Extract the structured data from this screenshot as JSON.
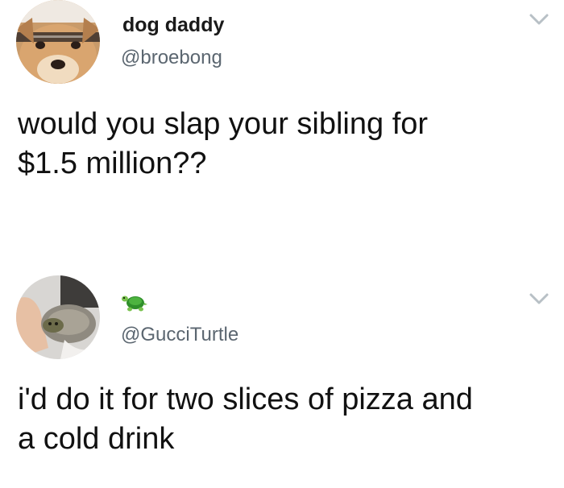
{
  "tweets": [
    {
      "display_name": "dog daddy",
      "handle": "@broebong",
      "text_lines": [
        "would you slap your sibling for",
        "$1.5 million??"
      ],
      "avatar_icon": "dog-photo",
      "menu_icon": "chevron-down-icon"
    },
    {
      "display_name_icon": "turtle-emoji",
      "handle": "@GucciTurtle",
      "text_lines": [
        "i'd do it for two slices of pizza and",
        "a cold drink"
      ],
      "avatar_icon": "turtle-in-hand-photo",
      "menu_icon": "chevron-down-icon"
    }
  ],
  "colors": {
    "background": "#ffffff",
    "text": "#111111",
    "handle": "#5b6670",
    "chevron": "#b8c0c6"
  }
}
